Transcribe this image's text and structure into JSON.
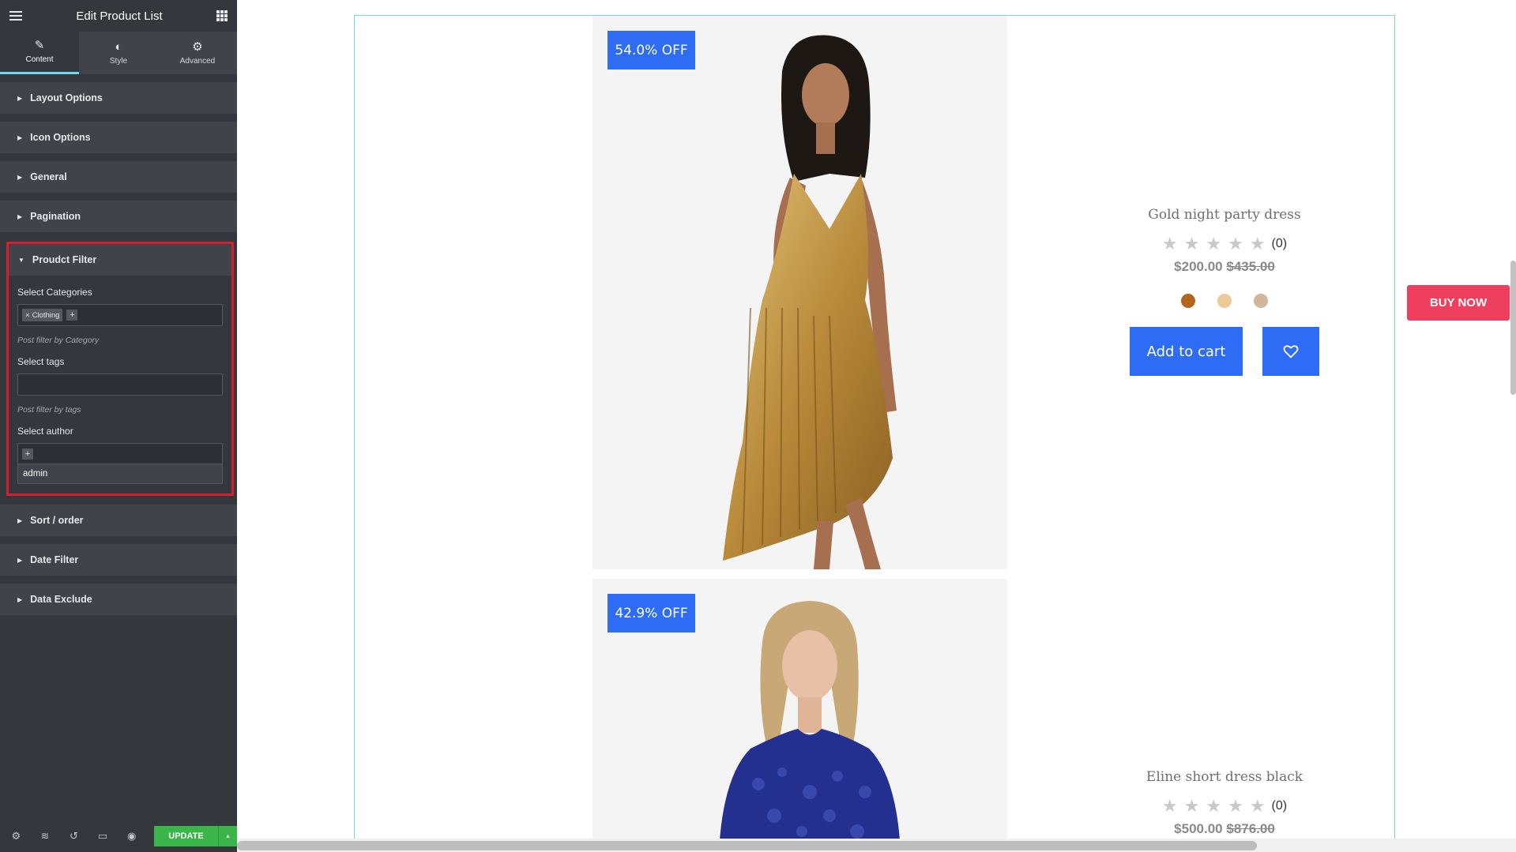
{
  "panel": {
    "title": "Edit Product List",
    "tabs": [
      {
        "label": "Content",
        "icon": "pencil-icon",
        "active": true
      },
      {
        "label": "Style",
        "icon": "half-circle-icon",
        "active": false
      },
      {
        "label": "Advanced",
        "icon": "gear-icon",
        "active": false
      }
    ],
    "sections_top": [
      "Layout Options",
      "Icon Options",
      "General",
      "Pagination"
    ],
    "product_filter": {
      "title": "Proudct Filter",
      "categories_label": "Select Categories",
      "categories_selected": [
        "Clothing"
      ],
      "categories_hint": "Post filter by Category",
      "tags_label": "Select tags",
      "tags_value": "",
      "tags_hint": "Post filter by tags",
      "author_label": "Select author",
      "author_option": "admin"
    },
    "sections_bottom": [
      "Sort / order",
      "Date Filter",
      "Data Exclude"
    ],
    "footer": {
      "icons": [
        "settings-icon",
        "layers-icon",
        "history-icon",
        "responsive-icon",
        "preview-eye-icon"
      ],
      "update_label": "UPDATE"
    }
  },
  "preview": {
    "products": [
      {
        "badge": "54.0% OFF",
        "name": "Gold night party dress",
        "rating_count": "(0)",
        "price_sale": "$200.00",
        "price_regular": "$435.00",
        "swatches": [
          "#b5651d",
          "#ecc998",
          "#d2b69b"
        ],
        "add_to_cart": "Add to cart"
      },
      {
        "badge": "42.9% OFF",
        "name": "Eline short dress black",
        "rating_count": "(0)",
        "price_sale": "$500.00",
        "price_regular": "$876.00"
      }
    ],
    "buy_now": "BUY NOW"
  },
  "colors": {
    "panel_bg": "#34383c",
    "section_bg": "#404349",
    "accent_blue": "#2f6cf6",
    "buy_now": "#ef3f5e",
    "update_green": "#39b54a",
    "highlight_red": "#d3202e"
  }
}
